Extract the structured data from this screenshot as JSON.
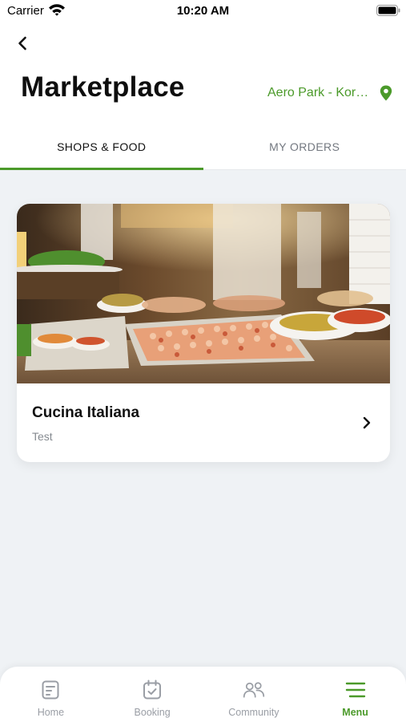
{
  "status_bar": {
    "carrier": "Carrier",
    "time": "10:20 AM"
  },
  "header": {
    "title": "Marketplace",
    "location": "Aero Park - Kortrijk"
  },
  "tabs": [
    {
      "label": "SHOPS & FOOD",
      "active": true
    },
    {
      "label": "MY ORDERS",
      "active": false
    }
  ],
  "shops": [
    {
      "name": "Cucina Italiana",
      "description": "Test",
      "image": "buffet-food-photo"
    }
  ],
  "bottom_nav": [
    {
      "label": "Home",
      "icon": "home-icon",
      "active": false
    },
    {
      "label": "Booking",
      "icon": "calendar-check-icon",
      "active": false
    },
    {
      "label": "Community",
      "icon": "people-icon",
      "active": false
    },
    {
      "label": "Menu",
      "icon": "menu-icon",
      "active": true
    }
  ],
  "colors": {
    "accent": "#4b9a2a",
    "background": "#eff2f5",
    "inactive": "#9a9ea5"
  }
}
